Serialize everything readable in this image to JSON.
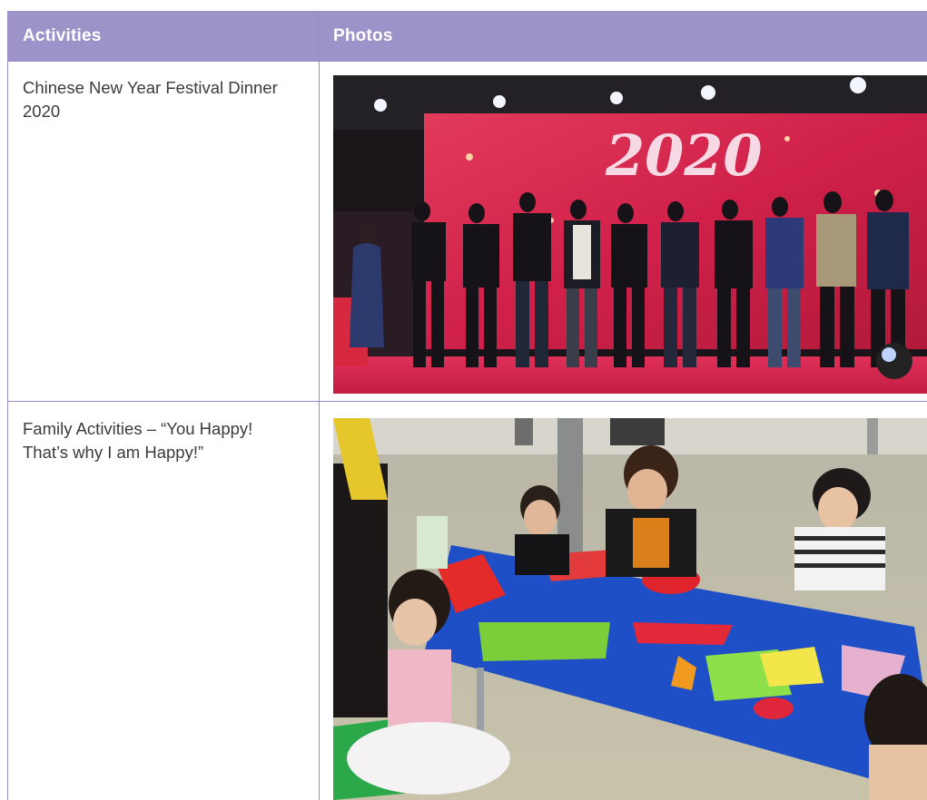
{
  "table": {
    "headers": [
      "Activities",
      "Photos"
    ],
    "rows": [
      {
        "activity": "Chinese New Year Festival Dinner 2020",
        "photo_caption": "2020"
      },
      {
        "activity": "Family Activities – “You Happy! That’s why I am Happy!”"
      }
    ]
  },
  "colors": {
    "header_bg": "#9e93c9",
    "border": "#9b8cc9",
    "text": "#3b3b3b"
  }
}
